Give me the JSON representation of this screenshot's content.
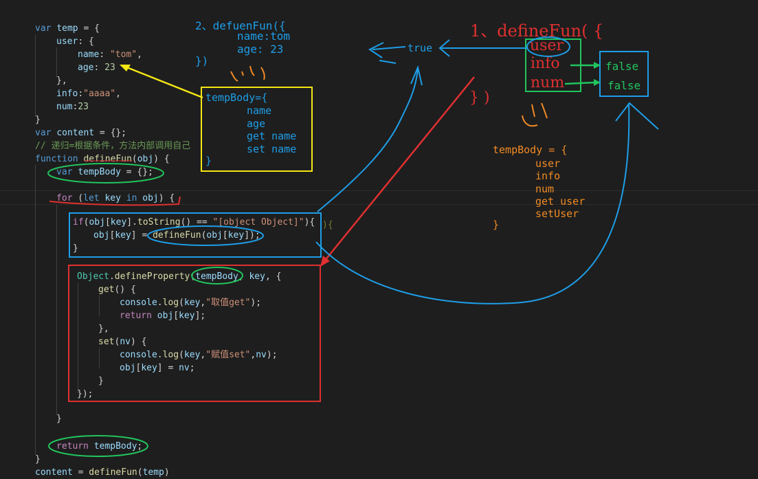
{
  "code": {
    "l01": {
      "a": "var",
      "b": "temp",
      "c": " = {"
    },
    "l02": {
      "a": "user",
      "b": ": {"
    },
    "l03": {
      "a": "name",
      "b": ": ",
      "c": "\"tom\"",
      "d": ","
    },
    "l04": {
      "a": "age",
      "b": ": ",
      "c": "23"
    },
    "l05": {
      "a": "},"
    },
    "l06": {
      "a": "info",
      "b": ":",
      "c": "\"aaaa\"",
      "d": ","
    },
    "l07": {
      "a": "num",
      "b": ":",
      "c": "23"
    },
    "l08": {
      "a": "}"
    },
    "l09": {
      "a": "var",
      "b": "content",
      "c": " = {};"
    },
    "l10": {
      "a": "// 递归=根据条件，方法内部调用自己"
    },
    "l11": {
      "a": "function",
      "b": "defineFun",
      "c": "(",
      "d": "obj",
      "e": ") {"
    },
    "l12": {
      "a": "var",
      "b": "tempBody",
      "c": " = {};"
    },
    "l13": {
      "a": "for",
      "b": " (",
      "c": "let",
      "d": "key",
      "e": "in",
      "f": "obj",
      "g": ") {"
    },
    "l14": {
      "a": "if",
      "b": "(",
      "c": "obj",
      "d": "[",
      "e": "key",
      "f": "].",
      "g": "toString",
      "h": "() == ",
      "i": "\"[object Object]\"",
      "j": "){"
    },
    "l15": {
      "a": "obj",
      "b": "[",
      "c": "key",
      "d": "] = ",
      "e": "defineFun",
      "f": "(",
      "g": "obj",
      "h": "[",
      "i": "key",
      "j": "]);"
    },
    "l16": {
      "a": "}"
    },
    "l17": {
      "a": "Object",
      "b": ".",
      "c": "defineProperty",
      "d": "(",
      "e": "tempBody",
      "f": ", ",
      "g": "key",
      "h": ", {"
    },
    "l18": {
      "a": "get",
      "b": "() {"
    },
    "l19": {
      "a": "console",
      "b": ".",
      "c": "log",
      "d": "(",
      "e": "key",
      "f": ",",
      "g": "\"取值get\"",
      "h": ");"
    },
    "l20": {
      "a": "return",
      "b": "obj",
      "c": "[",
      "d": "key",
      "e": "];"
    },
    "l21": {
      "a": "},"
    },
    "l22": {
      "a": "set",
      "b": "(",
      "c": "nv",
      "d": ") {"
    },
    "l23": {
      "a": "console",
      "b": ".",
      "c": "log",
      "d": "(",
      "e": "key",
      "f": ",",
      "g": "\"赋值set\"",
      "h": ",",
      "i": "nv",
      "j": ");"
    },
    "l24": {
      "a": "obj",
      "b": "[",
      "c": "key",
      "d": "] = ",
      "e": "nv",
      "f": ";"
    },
    "l25": {
      "a": "}"
    },
    "l26": {
      "a": "});"
    },
    "l27": {
      "a": "}"
    },
    "l28": {
      "a": "return",
      "b": "tempBody",
      "c": ";"
    },
    "l29": {
      "a": "}"
    },
    "l30": {
      "a": "content",
      "b": " = ",
      "c": "defineFun",
      "d": "(",
      "e": "temp",
      "f": ")"
    },
    "ghost_brace": "){"
  },
  "annotations": {
    "call2": {
      "l1": "2、defuenFun({",
      "l2": "name:tom",
      "l3": "age: 23",
      "l4": "})"
    },
    "tempbody_yellow": {
      "l1": "tempBody={",
      "l2": "name",
      "l3": "age",
      "l4": "get name",
      "l5": "set name",
      "l6": "}"
    },
    "call1": {
      "l1": "1、defineFun( {",
      "l2": "} )"
    },
    "keys": [
      "user",
      "info",
      "num"
    ],
    "falses": [
      "false",
      "false"
    ],
    "true_label": "true",
    "tempbody_orange": {
      "l1": "tempBody = {",
      "l2": "user",
      "l3": "info",
      "l4": "num",
      "l5": "get user",
      "l6": "setUser",
      "l7": "}"
    }
  },
  "colors": {
    "background": "#1e1e1e",
    "keyword": "#569cd6",
    "control": "#c586c0",
    "function": "#dcdcaa",
    "variable": "#9cdcfe",
    "string": "#ce9178",
    "number": "#b5cea8",
    "comment": "#6a9955",
    "annotation_red": "#e03030",
    "annotation_blue": "#1e9ee8",
    "annotation_green": "#22c55e",
    "annotation_yellow": "#f5e614",
    "annotation_orange": "#f08a24"
  }
}
